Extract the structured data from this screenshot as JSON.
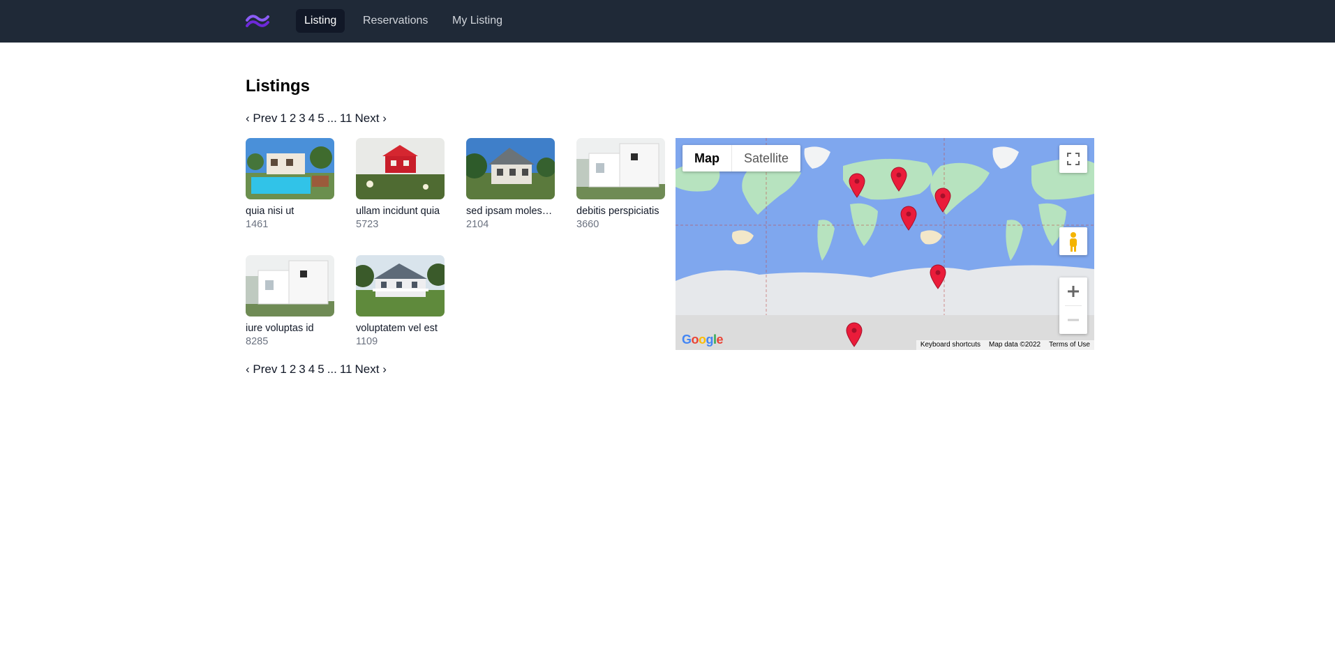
{
  "nav": {
    "items": [
      {
        "label": "Listing",
        "active": true
      },
      {
        "label": "Reservations",
        "active": false
      },
      {
        "label": "My Listing",
        "active": false
      }
    ]
  },
  "page": {
    "title": "Listings"
  },
  "pagination": {
    "prev": "‹ Prev",
    "pages": [
      "1",
      "2",
      "3",
      "4",
      "5"
    ],
    "ellipsis": "...",
    "last": "11",
    "next": "Next ›"
  },
  "listings": [
    {
      "name": "quia nisi ut",
      "price": "1461"
    },
    {
      "name": "ullam incidunt quia",
      "price": "5723"
    },
    {
      "name": "sed ipsam molestiae",
      "price": "2104"
    },
    {
      "name": "debitis perspiciatis",
      "price": "3660"
    },
    {
      "name": "iure voluptas id",
      "price": "8285"
    },
    {
      "name": "voluptatem vel est",
      "price": "1109"
    }
  ],
  "map": {
    "type_options": [
      "Map",
      "Satellite"
    ],
    "selected_type": "Map",
    "footer": {
      "shortcuts": "Keyboard shortcuts",
      "data": "Map data ©2022",
      "terms": "Terms of Use"
    },
    "logo_text": "Google",
    "icons": [
      "fullscreen-icon",
      "pegman-icon",
      "zoom-in-icon",
      "zoom-out-icon",
      "map-pin-icon"
    ],
    "pin_color": "#ea1c3a"
  },
  "colors": {
    "navbar": "#1f2937",
    "accent": "#7c3aed",
    "water": "#7fa7ee",
    "land": "#b7e3bf"
  }
}
